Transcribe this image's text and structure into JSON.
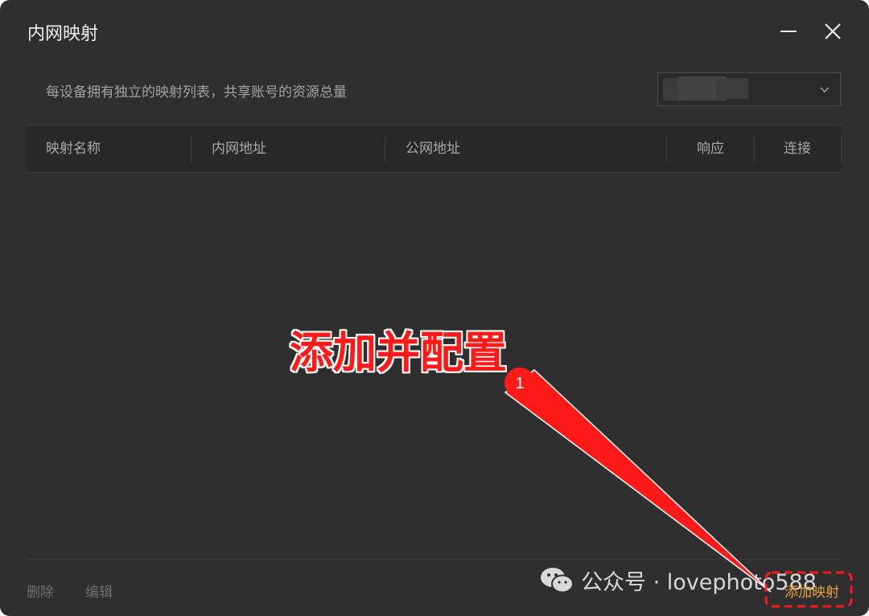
{
  "window": {
    "title": "内网映射",
    "minimize_icon": "minimize-icon",
    "close_icon": "close-icon"
  },
  "header": {
    "subtitle": "每设备拥有独立的映射列表，共享账号的资源总量",
    "device_select_icon": "chevron-down-icon"
  },
  "table": {
    "columns": [
      "映射名称",
      "内网地址",
      "公网地址",
      "响应",
      "连接"
    ],
    "rows": []
  },
  "footer": {
    "delete_label": "删除",
    "edit_label": "编辑",
    "add_label": "添加映射"
  },
  "annotation": {
    "text": "添加并配置",
    "step_number": "1",
    "color": "#ff1a1a"
  },
  "watermark": {
    "text": "公众号 · lovephoto588",
    "icon": "wechat-icon"
  },
  "colors": {
    "background": "#2f2f2f",
    "accent": "#e8a33c",
    "header_row": "#282828"
  }
}
